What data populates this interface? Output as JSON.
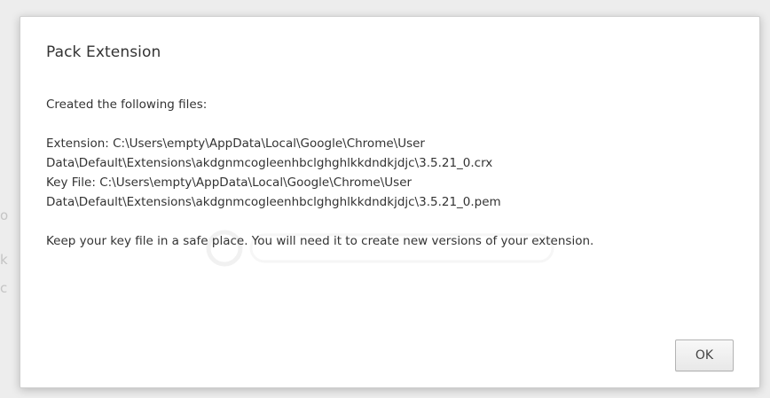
{
  "dialog": {
    "title": "Pack Extension",
    "intro": "Created the following files:",
    "extension_line1": "Extension: C:\\Users\\empty\\AppData\\Local\\Google\\Chrome\\User",
    "extension_line2": "Data\\Default\\Extensions\\akdgnmcogleenhbclghghlkkdndkjdjc\\3.5.21_0.crx",
    "keyfile_line1": "Key File: C:\\Users\\empty\\AppData\\Local\\Google\\Chrome\\User",
    "keyfile_line2": "Data\\Default\\Extensions\\akdgnmcogleenhbclghghlkkdndkjdjc\\3.5.21_0.pem",
    "note": "Keep your key file in a safe place. You will need it to create new versions of your extension.",
    "ok_label": "OK"
  }
}
